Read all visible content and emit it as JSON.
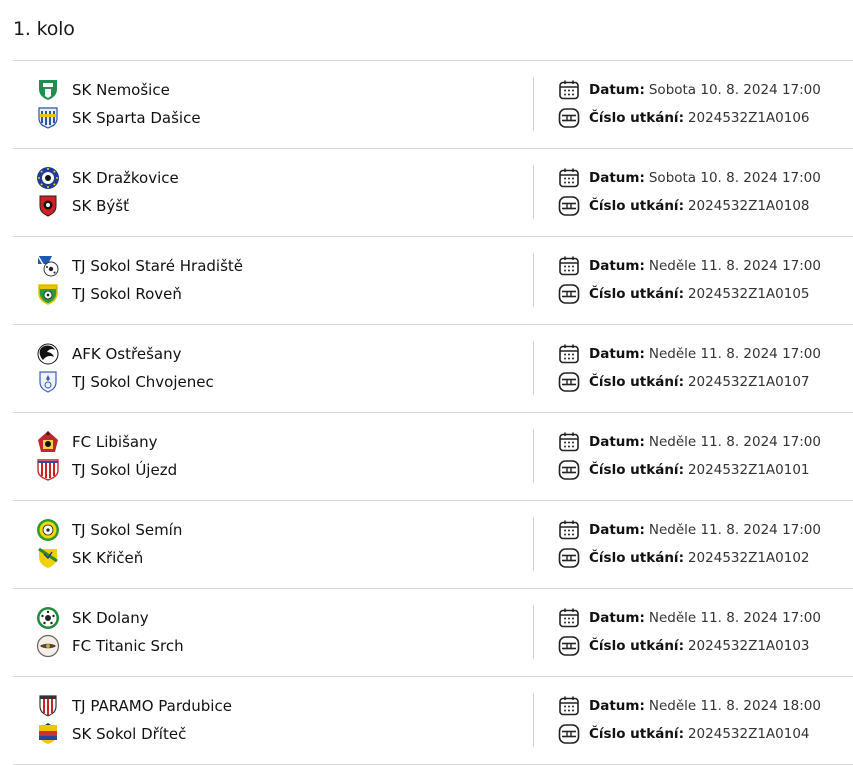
{
  "round": {
    "title": "1. kolo"
  },
  "labels": {
    "date": "Datum:",
    "match_no": "Číslo utkání:"
  },
  "matches": [
    {
      "home": "SK Nemošice",
      "away": "SK Sparta Dašice",
      "date": "Sobota 10. 8. 2024 17:00",
      "number": "2024532Z1A0106",
      "home_crest": "nemosice-crest",
      "away_crest": "dasice-crest"
    },
    {
      "home": "SK Dražkovice",
      "away": "SK Býšť",
      "date": "Sobota 10. 8. 2024 17:00",
      "number": "2024532Z1A0108",
      "home_crest": "drazkovice-crest",
      "away_crest": "byst-crest"
    },
    {
      "home": "TJ Sokol Staré Hradiště",
      "away": "TJ Sokol Roveň",
      "date": "Neděle 11. 8. 2024 17:00",
      "number": "2024532Z1A0105",
      "home_crest": "stare-hradiste-crest",
      "away_crest": "roven-crest"
    },
    {
      "home": "AFK Ostřešany",
      "away": "TJ Sokol Chvojenec",
      "date": "Neděle 11. 8. 2024 17:00",
      "number": "2024532Z1A0107",
      "home_crest": "ostresany-crest",
      "away_crest": "chvojenec-crest"
    },
    {
      "home": "FC Libišany",
      "away": "TJ Sokol Újezd",
      "date": "Neděle 11. 8. 2024 17:00",
      "number": "2024532Z1A0101",
      "home_crest": "libisany-crest",
      "away_crest": "ujezd-crest"
    },
    {
      "home": "TJ Sokol Semín",
      "away": "SK Křičeň",
      "date": "Neděle 11. 8. 2024 17:00",
      "number": "2024532Z1A0102",
      "home_crest": "semin-crest",
      "away_crest": "kricen-crest"
    },
    {
      "home": "SK Dolany",
      "away": "FC Titanic Srch",
      "date": "Neděle 11. 8. 2024 17:00",
      "number": "2024532Z1A0103",
      "home_crest": "dolany-crest",
      "away_crest": "srch-crest"
    },
    {
      "home": "TJ PARAMO Pardubice",
      "away": "SK Sokol Dříteč",
      "date": "Neděle 11. 8. 2024 18:00",
      "number": "2024532Z1A0104",
      "home_crest": "paramo-crest",
      "away_crest": "dritec-crest"
    }
  ],
  "icons": {
    "date": "calendar-icon",
    "match_no": "scoreboard-icon"
  }
}
